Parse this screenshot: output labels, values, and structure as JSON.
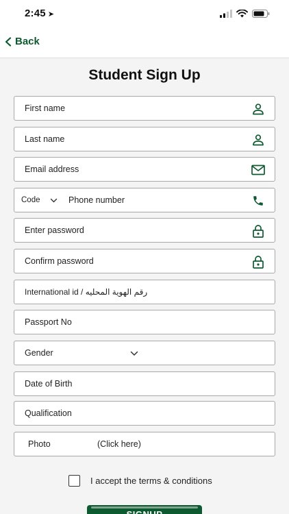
{
  "status_bar": {
    "time": "2:45"
  },
  "nav": {
    "back_label": "Back"
  },
  "page": {
    "title": "Student Sign Up"
  },
  "form": {
    "first_name": {
      "placeholder": "First name",
      "icon": "person-icon"
    },
    "last_name": {
      "placeholder": "Last name",
      "icon": "person-icon"
    },
    "email": {
      "placeholder": "Email address",
      "icon": "envelope-icon"
    },
    "phone": {
      "code_label": "Code",
      "placeholder": "Phone number",
      "icon": "phone-icon"
    },
    "password": {
      "placeholder": "Enter password",
      "icon": "lock-icon"
    },
    "confirm_password": {
      "placeholder": "Confirm password",
      "icon": "lock-icon"
    },
    "international_id": {
      "placeholder": "International id  /  رقم الهوية المحليه"
    },
    "passport": {
      "placeholder": "Passport No"
    },
    "gender": {
      "placeholder": "Gender"
    },
    "date_of_birth": {
      "placeholder": "Date of Birth"
    },
    "qualification": {
      "placeholder": "Qualification"
    },
    "photo": {
      "label": "Photo",
      "hint": "(Click here)"
    }
  },
  "terms": {
    "label": "I accept the terms & conditions"
  },
  "submit": {
    "label": "SIGNUP"
  },
  "colors": {
    "accent": "#0e5a30",
    "border": "#a8a8a8",
    "background": "#f4f4f4"
  }
}
